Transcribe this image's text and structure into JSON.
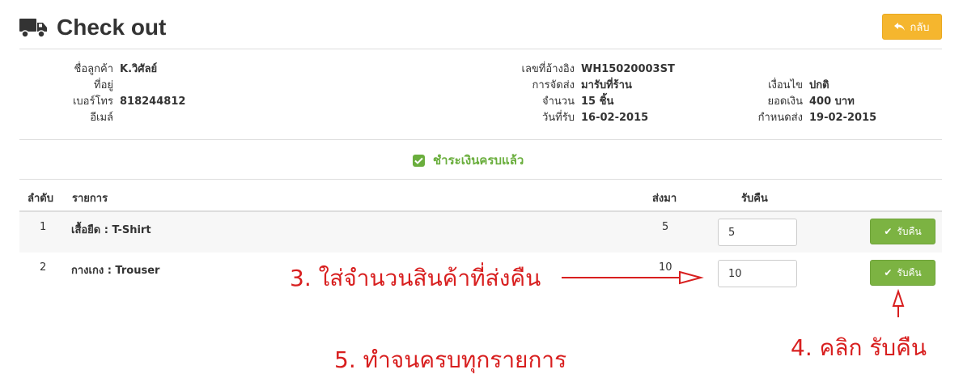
{
  "header": {
    "title": "Check out",
    "back_label": "กลับ"
  },
  "customer": {
    "name_label": "ชื่อลูกค้า",
    "name_value": "K.วิศัลย์",
    "address_label": "ที่อยู่",
    "address_value": "",
    "phone_label": "เบอร์โทร",
    "phone_value": "818244812",
    "email_label": "อีเมล์",
    "email_value": ""
  },
  "order": {
    "ref_label": "เลขที่อ้างอิง",
    "ref_value": "WH15020003ST",
    "shipping_label": "การจัดส่ง",
    "shipping_value": "มารับที่ร้าน",
    "amount_label": "จำนวน",
    "amount_value": "15 ชิ้น",
    "received_label": "วันที่รับ",
    "received_value": "16-02-2015"
  },
  "terms": {
    "condition_label": "เงื่อนไข",
    "condition_value": "ปกติ",
    "total_label": "ยอดเงิน",
    "total_value": "400 บาท",
    "due_label": "กำหนดส่ง",
    "due_value": "19-02-2015"
  },
  "paid_status": "ชำระเงินครบแล้ว",
  "table": {
    "headers": {
      "index": "ลำดับ",
      "item": "รายการ",
      "sent": "ส่งมา",
      "return": "รับคืน"
    },
    "rows": [
      {
        "index": "1",
        "item": "เสื้อยืด : T-Shirt",
        "sent": "5",
        "return_qty": "5",
        "button": "รับคืน"
      },
      {
        "index": "2",
        "item": "กางเกง : Trouser",
        "sent": "10",
        "return_qty": "10",
        "button": "รับคืน"
      }
    ]
  },
  "annotations": {
    "step3": "3. ใส่จำนวนสินค้าที่ส่งคืน",
    "step4": "4. คลิก รับคืน",
    "step5": "5. ทำจนครบทุกรายการ"
  },
  "colors": {
    "accent_green": "#7cb342",
    "back_orange": "#f5b62e",
    "annotation_red": "#d81f1f"
  },
  "icons": {
    "title": "truck-icon",
    "back": "reply-arrow-icon",
    "paid": "check-square-icon",
    "return": "check-icon"
  }
}
